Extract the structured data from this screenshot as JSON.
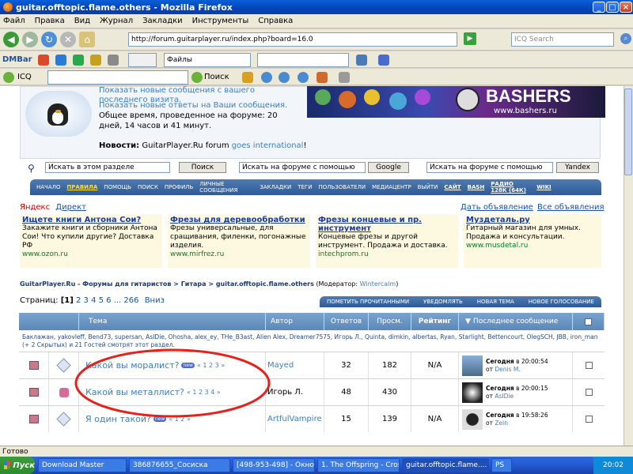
{
  "window": {
    "title": "guitar.offtopic.flame.others - Mozilla Firefox"
  },
  "menu": [
    "Файл",
    "Правка",
    "Вид",
    "Журнал",
    "Закладки",
    "Инструменты",
    "Справка"
  ],
  "nav": {
    "url": "http://forum.guitarplayer.ru/index.php?board=16.0",
    "search_placeholder": "ICQ Search"
  },
  "dmbar": {
    "label": "DMBar",
    "files_select": "Файлы"
  },
  "icqbar": {
    "label": "ICQ",
    "search_label": "Поиск"
  },
  "header": {
    "line1": "Показать новые сообщения с вашего последнего визита.",
    "line2": "Показать новые ответы на Ваши сообщения.",
    "line3": "Общее время, проведенное на форуме: 20 дней, 14 часов и 41 минут.",
    "news_label": "Новости:",
    "news_text": "GuitarPlayer.Ru forum",
    "news_link": "goes international",
    "news_end": "!",
    "banner_text": "BASHERS",
    "banner_url": "www.bashers.ru"
  },
  "search": {
    "section_value": "Искать в этом разделе",
    "section_button": "Поиск",
    "google_value": "Искать на форуме с помощью",
    "google_button": "Google",
    "yandex_value": "Искать на форуме с помощью",
    "yandex_button": "Yandex"
  },
  "forum_nav": [
    "НАЧАЛО",
    "ПРАВИЛА",
    "ПОМОЩЬ",
    "ПОИСК",
    "ПРОФИЛЬ",
    "ЛИЧНЫЕ СООБЩЕНИЯ",
    "ЗАКЛАДКИ",
    "ТЕГИ",
    "ПОЛЬЗОВАТЕЛИ",
    "МЕДИАЦЕНТР",
    "ВЫЙТИ",
    "САЙТ",
    "BASH",
    "РАДИО 128К (64К)",
    "WIKI"
  ],
  "ads_bar": {
    "yandex": "Яндекс",
    "direct": "Директ",
    "submit": "Дать объявление",
    "all": "Все объявления"
  },
  "ads": [
    {
      "title": "Ищете книги Антона Сои?",
      "text": "Закажите книги и сборники Антона Сои! Что купили другие? Доставка РФ",
      "url": "www.ozon.ru"
    },
    {
      "title": "Фрезы для деревообработки",
      "text": "Фрезы универсальные, для сращивания, филенки, погонажные изделия.",
      "url": "www.mirfrez.ru"
    },
    {
      "title": "Фрезы концевые и пр. инструмент",
      "text": "Концевые фрезы и другой инструмент. Продажа и доставка.",
      "url": "intechprom.ru"
    },
    {
      "title": "Муздеталь.ру",
      "text": "Гитарный магазин для умных. Продажа и консультации.",
      "url": "www.musdetal.ru"
    }
  ],
  "breadcrumb": {
    "text": "GuitarPlayer.Ru - Форумы для гитаристов > Гитара > guitar.offtopic.flame.others",
    "moderator_label": "(Модератор:",
    "moderator": "Wintercalm",
    "end": ")"
  },
  "pages": {
    "label": "Страниц:",
    "current": "[1]",
    "others": "2 3 4 5 6 ... 266",
    "down": "Вниз"
  },
  "actions": [
    "ПОМЕТИТЬ ПРОЧИТАННЫМИ",
    "УВЕДОМЛЯТЬ",
    "НОВАЯ ТЕМА",
    "НОВОЕ ГОЛОСОВАНИЕ"
  ],
  "columns": [
    "Тема",
    "Автор",
    "Ответов",
    "Просм.",
    "Рейтинг",
    "Последнее сообщение"
  ],
  "viewers": "Баклажан, yakovleff, Bend73, supersan, AsIDie, Ohosha, alex_ey, THe_B3ast, Alien Alex, Dreamer7575, Игорь Л., Quinta, dimkin, albertas, Ryan, Starlight, Bettencourt, OlegSCH, JBB, iron_man (+ 2 Скрытых) и 21 Гостей смотрят этот раздел.",
  "topics": [
    {
      "title": "Какой вы моралист?",
      "pages": "« 1 2 3 »",
      "author": "Mayed",
      "replies": "32",
      "views": "182",
      "rating": "N/A",
      "last_date": "Сегодня",
      "last_time": "в 20:00:54",
      "last_by": "от",
      "last_user": "Denis M."
    },
    {
      "title": "Какой вы металлист?",
      "pages": "« 1 2 3 4 »",
      "author": "Игорь Л.",
      "replies": "48",
      "views": "430",
      "rating": "",
      "last_date": "Сегодня",
      "last_time": "в 20:00:15",
      "last_by": "от",
      "last_user": "AsIDie"
    },
    {
      "title": "Я один такой?",
      "pages": "« 1 2 »",
      "author": "ArtfulVampire",
      "replies": "15",
      "views": "139",
      "rating": "N/A",
      "last_date": "Сегодня",
      "last_time": "в 19:58:26",
      "last_by": "от",
      "last_user": "Zein"
    }
  ],
  "new_badge": "new",
  "status": "Готово",
  "taskbar": {
    "start": "Пуск",
    "tasks": [
      "Download Master",
      "386876655_Сосиска",
      "[498-953-498] - Окно ...",
      "1. The Offspring - Cros...",
      "guitar.offtopic.flame....",
      "PS"
    ],
    "clock": "20:02"
  },
  "colors": {
    "accent": "#5b88b9",
    "highlight_circle": "#e8201a"
  }
}
